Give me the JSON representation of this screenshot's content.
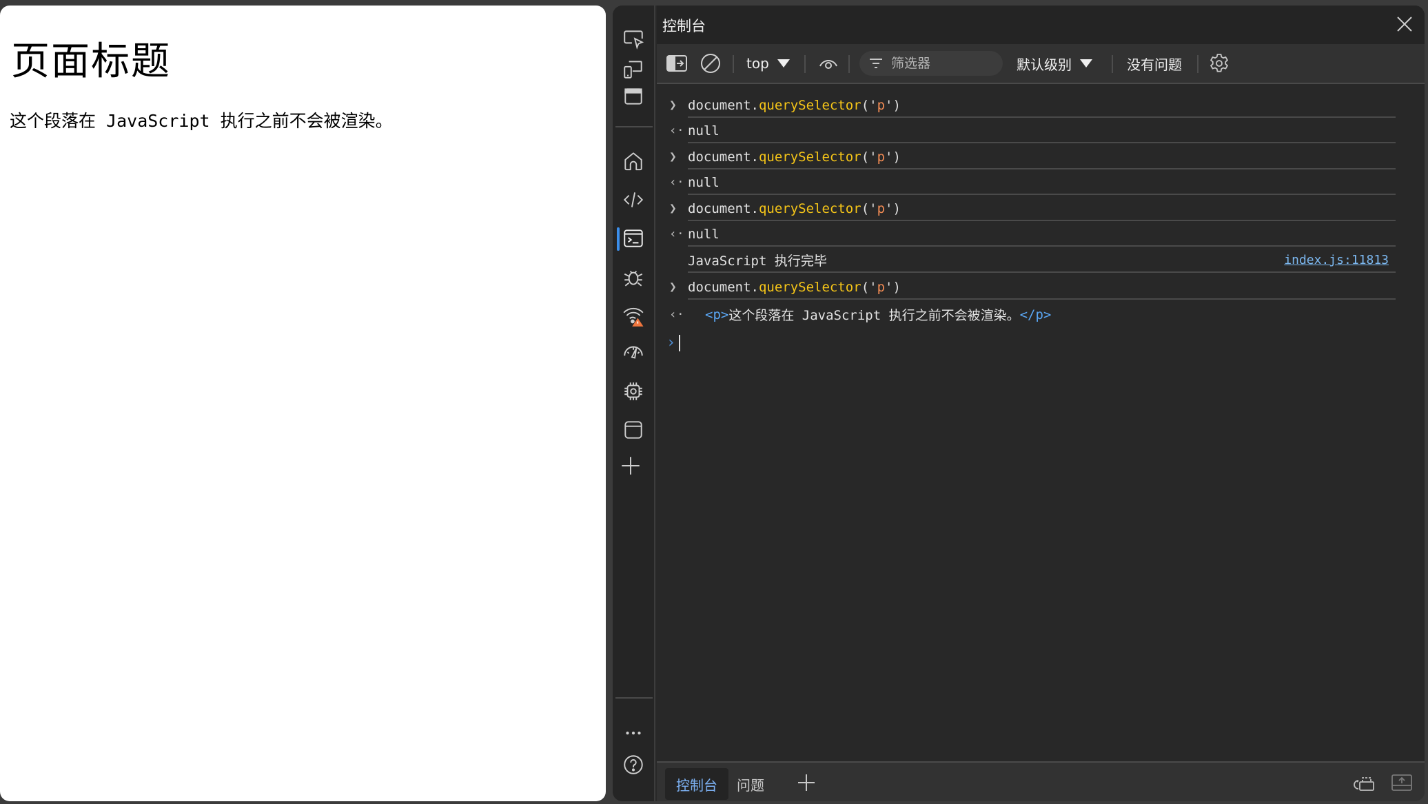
{
  "page": {
    "heading": "页面标题",
    "paragraph": "这个段落在 JavaScript 执行之前不会被渲染。"
  },
  "devtools": {
    "title": "控制台",
    "activity_bar": {
      "top_icons": [
        "inspect-icon",
        "device-emulation-icon",
        "dock-icon"
      ],
      "tools": [
        "home-icon",
        "elements-icon",
        "console-icon",
        "debugger-icon",
        "network-icon",
        "performance-icon",
        "memory-icon",
        "application-icon",
        "add-tool-icon"
      ],
      "active_tool": "console-icon",
      "network_warning": true,
      "bottom_icons": [
        "more-icon",
        "help-icon"
      ]
    },
    "toolbar": {
      "context_label": "top",
      "filter_placeholder": "筛选器",
      "filter_value": "",
      "level_label": "默认级别",
      "issues_label": "没有问题"
    },
    "console": {
      "entries": [
        {
          "type": "input",
          "object": "document",
          "method": "querySelector",
          "open": "('",
          "arg": "p",
          "close": "')"
        },
        {
          "type": "result",
          "value": "null"
        },
        {
          "type": "input",
          "object": "document",
          "method": "querySelector",
          "open": "('",
          "arg": "p",
          "close": "')"
        },
        {
          "type": "result",
          "value": "null"
        },
        {
          "type": "input",
          "object": "document",
          "method": "querySelector",
          "open": "('",
          "arg": "p",
          "close": "')"
        },
        {
          "type": "result",
          "value": "null"
        },
        {
          "type": "log",
          "message": "JavaScript 执行完毕",
          "source": "index.js:11813"
        },
        {
          "type": "input",
          "object": "document",
          "method": "querySelector",
          "open": "('",
          "arg": "p",
          "close": "')"
        },
        {
          "type": "element-result",
          "open_tag": "<p>",
          "text": "这个段落在 JavaScript 执行之前不会被渲染。",
          "close_tag": "</p>"
        }
      ]
    },
    "drawer": {
      "tabs": [
        {
          "label": "控制台",
          "active": true
        },
        {
          "label": "问题",
          "active": false
        }
      ]
    },
    "colors": {
      "accent": "#3b8eea",
      "method": "#f5c518",
      "string": "#f28b54",
      "tag": "#5aa7f5",
      "link": "#7cb8f0",
      "warning": "#f0763e"
    }
  }
}
